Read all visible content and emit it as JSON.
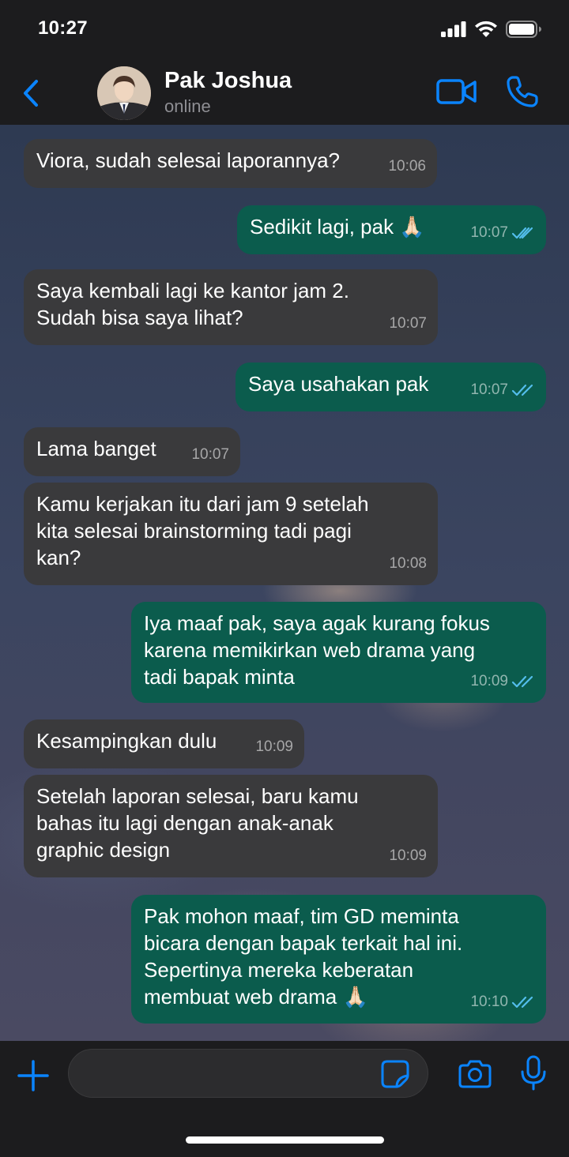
{
  "status_bar": {
    "time": "10:27"
  },
  "header": {
    "contact_name": "Pak Joshua",
    "contact_status": "online",
    "icons": [
      "chevron-left-icon",
      "video-camera-icon",
      "phone-icon"
    ]
  },
  "colors": {
    "accent": "#0a84ff",
    "incoming_bubble": "#3a3a3c",
    "outgoing_bubble": "#0b5c4d",
    "read_ticks": "#53bdeb",
    "bar_background": "#1c1c1e"
  },
  "messages": [
    {
      "direction": "in",
      "text": "Viora, sudah selesai laporannya?",
      "time": "10:06"
    },
    {
      "direction": "out",
      "text": "Sedikit lagi, pak 🙏🏻",
      "time": "10:07",
      "status": "read"
    },
    {
      "direction": "in",
      "text": "Saya kembali lagi ke kantor jam 2.\nSudah bisa saya lihat?",
      "time": "10:07"
    },
    {
      "direction": "out",
      "text": "Saya usahakan pak",
      "time": "10:07",
      "status": "read"
    },
    {
      "direction": "in",
      "text": "Lama banget",
      "time": "10:07"
    },
    {
      "direction": "in",
      "text": "Kamu kerjakan itu dari jam 9 setelah\nkita selesai brainstorming tadi pagi\nkan?",
      "time": "10:08"
    },
    {
      "direction": "out",
      "text": "Iya maaf pak, saya agak kurang fokus\nkarena memikirkan web drama yang\ntadi bapak minta",
      "time": "10:09",
      "status": "read"
    },
    {
      "direction": "in",
      "text": "Kesampingkan dulu",
      "time": "10:09"
    },
    {
      "direction": "in",
      "text": "Setelah laporan selesai, baru kamu\nbahas itu lagi dengan anak-anak\ngraphic design",
      "time": "10:09"
    },
    {
      "direction": "out",
      "text": "Pak mohon maaf, tim GD meminta\nbicara dengan bapak terkait hal ini.\nSepertinya mereka keberatan\nmembuat web drama 🙏🏻",
      "time": "10:10",
      "status": "read"
    }
  ],
  "input_bar": {
    "message_value": "",
    "icons": [
      "plus-icon",
      "sticker-icon",
      "camera-icon",
      "microphone-icon"
    ]
  }
}
